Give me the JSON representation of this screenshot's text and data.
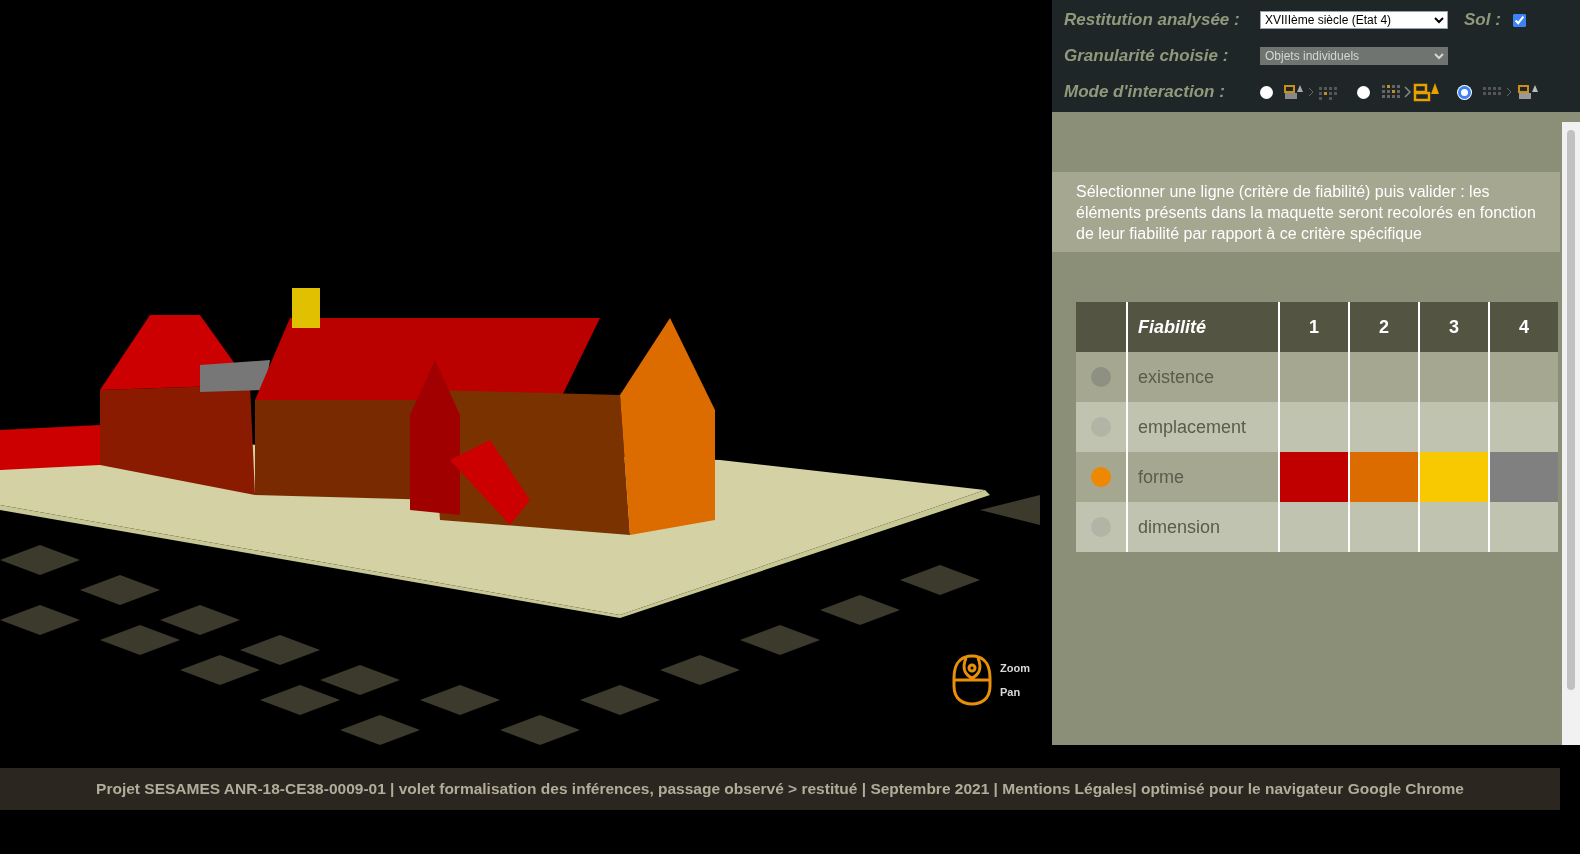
{
  "controls": {
    "restitution": {
      "label": "Restitution analysée :",
      "value": "XVIIIème siècle (Etat 4)"
    },
    "sol": {
      "label": "Sol :",
      "checked": true
    },
    "granularite": {
      "label": "Granularité choisie :",
      "value": "Objets individuels",
      "disabled": true
    },
    "mode": {
      "label": "Mode d'interaction :",
      "options": [
        {
          "selected": false
        },
        {
          "selected": false
        },
        {
          "selected": true
        }
      ]
    }
  },
  "instructions": "Sélectionner une ligne (critère de fiabilité) puis valider : les éléments présents dans la maquette seront recolorés en fonction de leur fiabilité par rapport à ce critère spécifique",
  "table": {
    "columns": [
      "Fiabilité",
      "1",
      "2",
      "3",
      "4"
    ],
    "rows": [
      {
        "label": "existence",
        "selected": false
      },
      {
        "label": "emplacement",
        "selected": false
      },
      {
        "label": "forme",
        "selected": true,
        "cells": [
          {
            "color": "#c00000"
          },
          {
            "color": "#dd6c00"
          },
          {
            "color": "#f8c800"
          },
          {
            "color": "#808080"
          }
        ]
      },
      {
        "label": "dimension",
        "selected": false
      }
    ]
  },
  "mouse_legend": [
    "Zoom",
    "Pan"
  ],
  "footer": "Projet SESAMES ANR-18-CE38-0009-01 | volet formalisation des inférences, passage observé > restitué | Septembre 2021 | Mentions Légales| optimisé pour le navigateur Google Chrome"
}
